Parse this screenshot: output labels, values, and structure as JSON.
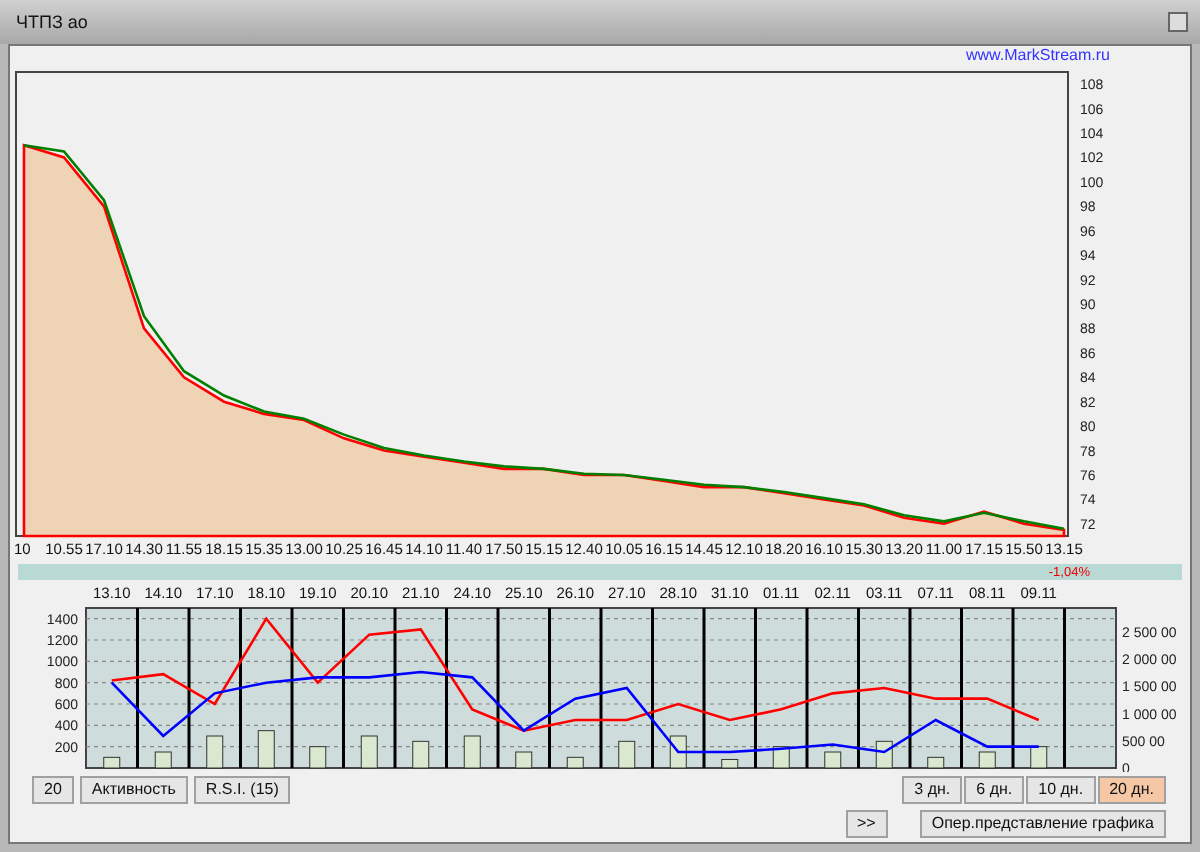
{
  "window": {
    "title": "ЧТПЗ ао"
  },
  "site_link": "www.MarkStream.ru",
  "price_chart": {
    "chart_data": {
      "type": "area",
      "categories": [
        "10",
        "10.55",
        "17.10",
        "14.30",
        "11.55",
        "18.15",
        "15.35",
        "13.00",
        "10.25",
        "16.45",
        "14.10",
        "11.40",
        "17.50",
        "15.15",
        "12.40",
        "10.05",
        "16.15",
        "14.45",
        "12.10",
        "18.20",
        "16.10",
        "15.30",
        "13.20",
        "11.00",
        "17.15",
        "15.50",
        "13.15"
      ],
      "ylim": [
        71,
        109
      ],
      "yticks": [
        72,
        74,
        76,
        78,
        80,
        82,
        84,
        86,
        88,
        90,
        92,
        94,
        96,
        98,
        100,
        102,
        104,
        106,
        108
      ],
      "series": [
        {
          "type": "area",
          "color": "#ff0000",
          "values": [
            103,
            102,
            98,
            88,
            84,
            82,
            81,
            80.5,
            79,
            78,
            77.5,
            77,
            76.5,
            76.5,
            76,
            76,
            75.5,
            75,
            75,
            74.5,
            74,
            73.5,
            72.5,
            72,
            73,
            72,
            71.5
          ]
        },
        {
          "type": "line",
          "color": "#008000",
          "values": [
            103,
            102.5,
            98.5,
            89,
            84.5,
            82.5,
            81.2,
            80.6,
            79.3,
            78.2,
            77.6,
            77.1,
            76.7,
            76.5,
            76.1,
            76,
            75.6,
            75.2,
            75,
            74.6,
            74.1,
            73.6,
            72.7,
            72.2,
            72.9,
            72.2,
            71.6
          ]
        }
      ]
    }
  },
  "change_label": "-1,04%",
  "activity_chart": {
    "chart_data": {
      "type": "line",
      "categories": [
        "13.10",
        "14.10",
        "17.10",
        "18.10",
        "19.10",
        "20.10",
        "21.10",
        "24.10",
        "25.10",
        "26.10",
        "27.10",
        "28.10",
        "31.10",
        "01.11",
        "02.11",
        "03.11",
        "07.11",
        "08.11",
        "09.11"
      ],
      "ylim": [
        0,
        1500
      ],
      "yticks": [
        200,
        400,
        600,
        800,
        1000,
        1200,
        1400
      ],
      "grid": true,
      "series": [
        {
          "type": "bar",
          "color": "#d9e8cf",
          "values": [
            100,
            150,
            300,
            350,
            200,
            300,
            250,
            300,
            150,
            100,
            250,
            300,
            80,
            200,
            150,
            250,
            100,
            150,
            200
          ]
        },
        {
          "type": "line",
          "color": "#ff0000",
          "values": [
            820,
            880,
            600,
            1400,
            800,
            1250,
            1300,
            550,
            350,
            450,
            450,
            600,
            450,
            550,
            700,
            750,
            650,
            650,
            450
          ]
        },
        {
          "type": "line",
          "color": "#0000ff",
          "values": [
            800,
            300,
            700,
            800,
            850,
            850,
            900,
            850,
            350,
            650,
            750,
            150,
            150,
            180,
            220,
            150,
            450,
            200,
            200
          ]
        }
      ]
    },
    "right_axis_labels": [
      "2 500 00",
      "2 000 00",
      "1 500 00",
      "1 000 00",
      "500 00",
      "0"
    ]
  },
  "tool_buttons": [
    {
      "label": "20"
    },
    {
      "label": "Активность"
    },
    {
      "label": "R.S.I.  (15)"
    }
  ],
  "period_buttons": [
    {
      "label": "3 дн.",
      "selected": false
    },
    {
      "label": "6 дн.",
      "selected": false
    },
    {
      "label": "10 дн.",
      "selected": false
    },
    {
      "label": "20 дн.",
      "selected": true
    }
  ],
  "scroll_button": ">>",
  "mode_button": "Опер.представление графика"
}
